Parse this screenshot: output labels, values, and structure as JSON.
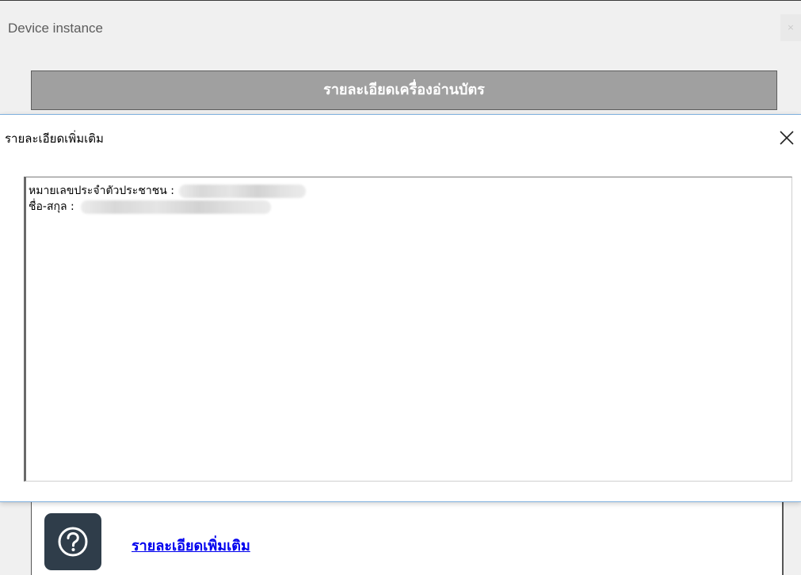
{
  "background_window": {
    "title": "Device instance",
    "close_glyph": "×",
    "header_button_label": "รายละเอียดเครื่องอ่านบัตร",
    "help_icon": "help-question-icon",
    "help_link_label": "รายละเอียดเพิ่มเติม"
  },
  "dialog": {
    "title": "รายละเอียดเพิ่มเติม",
    "close_icon": "close-icon",
    "lines": [
      {
        "label": "หมายเลขประจำตัวประชาชน :"
      },
      {
        "label": "ชื่อ-สกุล :"
      }
    ]
  },
  "colors": {
    "header_button_bg": "#a0a0a0",
    "help_icon_bg": "#2f3d4a",
    "link_color": "#0000ee",
    "dialog_border": "#7fb0de"
  }
}
